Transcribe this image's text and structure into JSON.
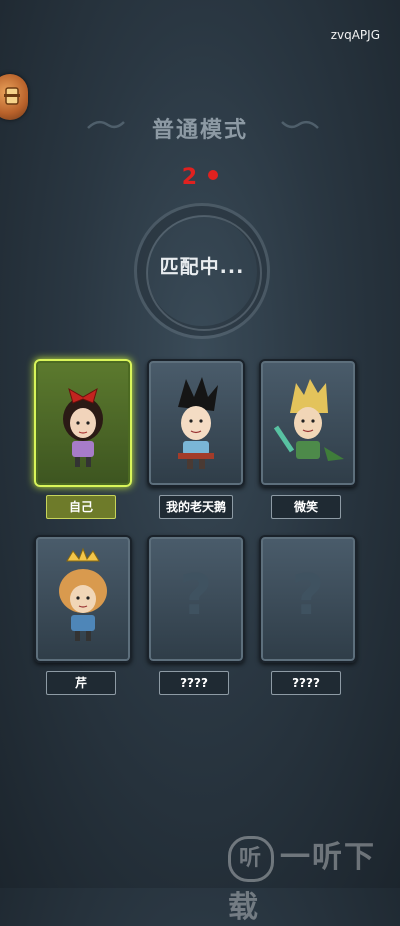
{
  "header": {
    "user_id": "zvqAPJG"
  },
  "mode": {
    "title": "普通模式",
    "countdown": "2"
  },
  "matching": {
    "status": "匹配中..."
  },
  "players": [
    {
      "name": "自己",
      "is_self": true,
      "revealed": true
    },
    {
      "name": "我的老天鹅",
      "is_self": false,
      "revealed": true
    },
    {
      "name": "微笑",
      "is_self": false,
      "revealed": true
    },
    {
      "name": "芹",
      "is_self": false,
      "revealed": true
    },
    {
      "name": "????",
      "is_self": false,
      "revealed": false,
      "placeholder": "?"
    },
    {
      "name": "????",
      "is_self": false,
      "revealed": false,
      "placeholder": "?"
    }
  ],
  "watermark": {
    "text": "一听下载",
    "icon_glyph": "听"
  },
  "colors": {
    "accent_red": "#e0211f",
    "self_highlight": "#d9f55a"
  }
}
